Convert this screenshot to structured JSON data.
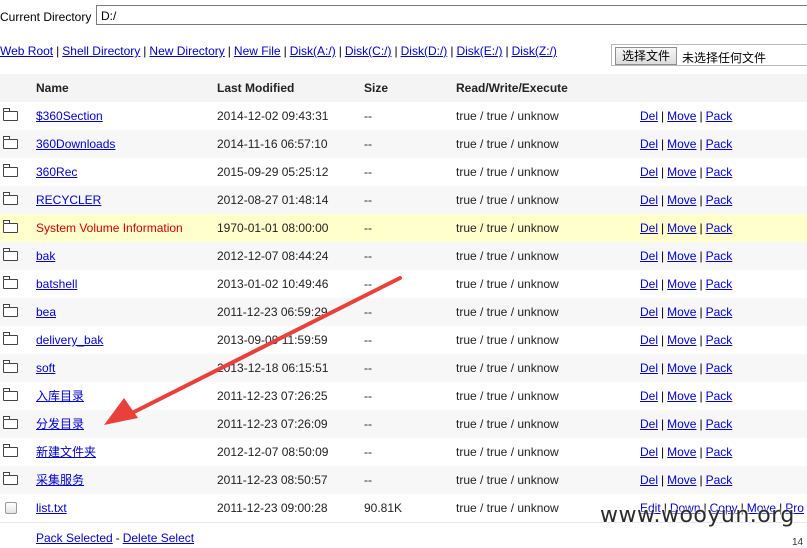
{
  "directory": {
    "label": "Current Directory",
    "value": "D:/"
  },
  "nav_links": [
    "Web Root",
    "Shell Directory",
    "New Directory",
    "New File",
    "Disk(A:/)",
    "Disk(C:/)",
    "Disk(D:/)",
    "Disk(E:/)",
    "Disk(Z:/)"
  ],
  "upload": {
    "button_label": "选择文件",
    "status_text": "未选择任何文件"
  },
  "table": {
    "headers": {
      "name": "Name",
      "modified": "Last Modified",
      "size": "Size",
      "perms": "Read/Write/Execute"
    },
    "rows": [
      {
        "type": "folder",
        "name": "$360Section",
        "modified": "2014-12-02 09:43:31",
        "size": "--",
        "perms": "true / true / unknow",
        "actions": [
          "Del",
          "Move",
          "Pack"
        ]
      },
      {
        "type": "folder",
        "name": "360Downloads",
        "modified": "2014-11-16 06:57:10",
        "size": "--",
        "perms": "true / true / unknow",
        "actions": [
          "Del",
          "Move",
          "Pack"
        ]
      },
      {
        "type": "folder",
        "name": "360Rec",
        "modified": "2015-09-29 05:25:12",
        "size": "--",
        "perms": "true / true / unknow",
        "actions": [
          "Del",
          "Move",
          "Pack"
        ]
      },
      {
        "type": "folder",
        "name": "RECYCLER",
        "modified": "2012-08-27 01:48:14",
        "size": "--",
        "perms": "true / true / unknow",
        "actions": [
          "Del",
          "Move",
          "Pack"
        ]
      },
      {
        "type": "folder",
        "name": "System Volume Information",
        "modified": "1970-01-01 08:00:00",
        "size": "--",
        "perms": "true / true / unknow",
        "actions": [
          "Del",
          "Move",
          "Pack"
        ],
        "highlight": true
      },
      {
        "type": "folder",
        "name": "bak",
        "modified": "2012-12-07 08:44:24",
        "size": "--",
        "perms": "true / true / unknow",
        "actions": [
          "Del",
          "Move",
          "Pack"
        ]
      },
      {
        "type": "folder",
        "name": "batshell",
        "modified": "2013-01-02 10:49:46",
        "size": "--",
        "perms": "true / true / unknow",
        "actions": [
          "Del",
          "Move",
          "Pack"
        ]
      },
      {
        "type": "folder",
        "name": "bea",
        "modified": "2011-12-23 06:59:29",
        "size": "--",
        "perms": "true / true / unknow",
        "actions": [
          "Del",
          "Move",
          "Pack"
        ]
      },
      {
        "type": "folder",
        "name": "delivery_bak",
        "modified": "2013-09-09 11:59:59",
        "size": "--",
        "perms": "true / true / unknow",
        "actions": [
          "Del",
          "Move",
          "Pack"
        ]
      },
      {
        "type": "folder",
        "name": "soft",
        "modified": "2013-12-18 06:15:51",
        "size": "--",
        "perms": "true / true / unknow",
        "actions": [
          "Del",
          "Move",
          "Pack"
        ]
      },
      {
        "type": "folder",
        "name": "入库目录",
        "modified": "2011-12-23 07:26:25",
        "size": "--",
        "perms": "true / true / unknow",
        "actions": [
          "Del",
          "Move",
          "Pack"
        ]
      },
      {
        "type": "folder",
        "name": "分发目录",
        "modified": "2011-12-23 07:26:09",
        "size": "--",
        "perms": "true / true / unknow",
        "actions": [
          "Del",
          "Move",
          "Pack"
        ]
      },
      {
        "type": "folder",
        "name": "新建文件夹",
        "modified": "2012-12-07 08:50:09",
        "size": "--",
        "perms": "true / true / unknow",
        "actions": [
          "Del",
          "Move",
          "Pack"
        ]
      },
      {
        "type": "folder",
        "name": "采集服务",
        "modified": "2011-12-23 08:50:57",
        "size": "--",
        "perms": "true / true / unknow",
        "actions": [
          "Del",
          "Move",
          "Pack"
        ]
      },
      {
        "type": "file",
        "name": "list.txt",
        "modified": "2011-12-23 09:00:28",
        "size": "90.81K",
        "perms": "true / true / unknow",
        "actions": [
          "Edit",
          "Down",
          "Copy",
          "Move",
          "Pro"
        ]
      }
    ]
  },
  "footer": {
    "pack_selected": "Pack Selected",
    "delete_selected": "Delete Select",
    "page_fragment": "14"
  },
  "watermark": "www.wooyun.org",
  "colors": {
    "link": "#0000cc",
    "highlight_row": "#ffffcc",
    "highlight_text": "#cc0000",
    "arrow": "#e8403a"
  }
}
